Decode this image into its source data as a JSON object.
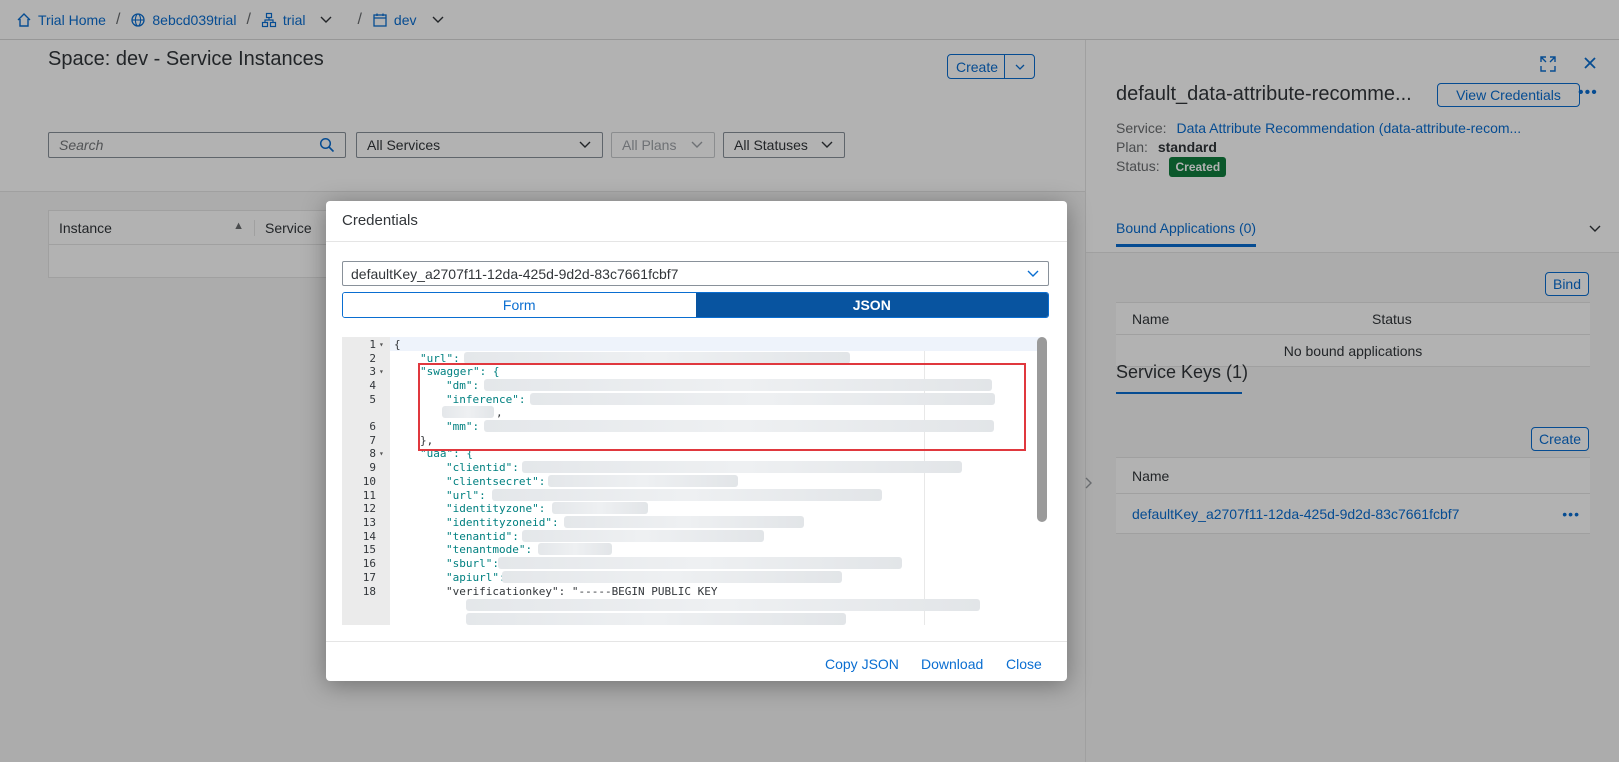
{
  "breadcrumb": {
    "home": "Trial Home",
    "account": "8ebcd039trial",
    "org": "trial",
    "space": "dev"
  },
  "page": {
    "title": "Space: dev - Service Instances",
    "create_label": "Create",
    "search_placeholder": "Search",
    "filter_services": "All Services",
    "filter_plans": "All Plans",
    "filter_statuses": "All Statuses",
    "columns": [
      "Instance",
      "Service"
    ]
  },
  "panel": {
    "title": "default_data-attribute-recomme...",
    "view_credentials": "View Credentials",
    "service_label": "Service:",
    "service_value": "Data Attribute Recommendation (data-attribute-recom...",
    "plan_label": "Plan:",
    "plan_value": "standard",
    "status_label": "Status:",
    "status_value": "Created",
    "bound_tab": "Bound Applications (0)",
    "bind_label": "Bind",
    "bound_cols": [
      "Name",
      "Status"
    ],
    "bound_empty": "No bound applications",
    "keys_title": "Service Keys (1)",
    "keys_create": "Create",
    "keys_col": "Name",
    "key_name": "defaultKey_a2707f11-12da-425d-9d2d-83c7661fcbf7"
  },
  "modal": {
    "title": "Credentials",
    "selected_key": "defaultKey_a2707f11-12da-425d-9d2d-83c7661fcbf7",
    "tab_form": "Form",
    "tab_json": "JSON",
    "copy_json": "Copy JSON",
    "download": "Download",
    "close": "Close",
    "line_numbers": [
      "1",
      "2",
      "3",
      "4",
      "5",
      "",
      "6",
      "7",
      "8",
      "9",
      "10",
      "11",
      "12",
      "13",
      "14",
      "15",
      "16",
      "17",
      "18"
    ],
    "code_lines": [
      "{",
      "\"url\":",
      "\"swagger\": {",
      "\"dm\":",
      "\"inference\":",
      ",",
      "\"mm\":",
      "},",
      "\"uaa\": {",
      "\"clientid\":",
      "\"clientsecret\":",
      "\"url\":",
      "\"identityzone\":",
      "\"identityzoneid\":",
      "\"tenantid\":",
      "\"tenantmode\":",
      "\"sburl\":",
      "\"apiurl\":",
      "\"verificationkey\": \"-----BEGIN PUBLIC KEY"
    ]
  }
}
